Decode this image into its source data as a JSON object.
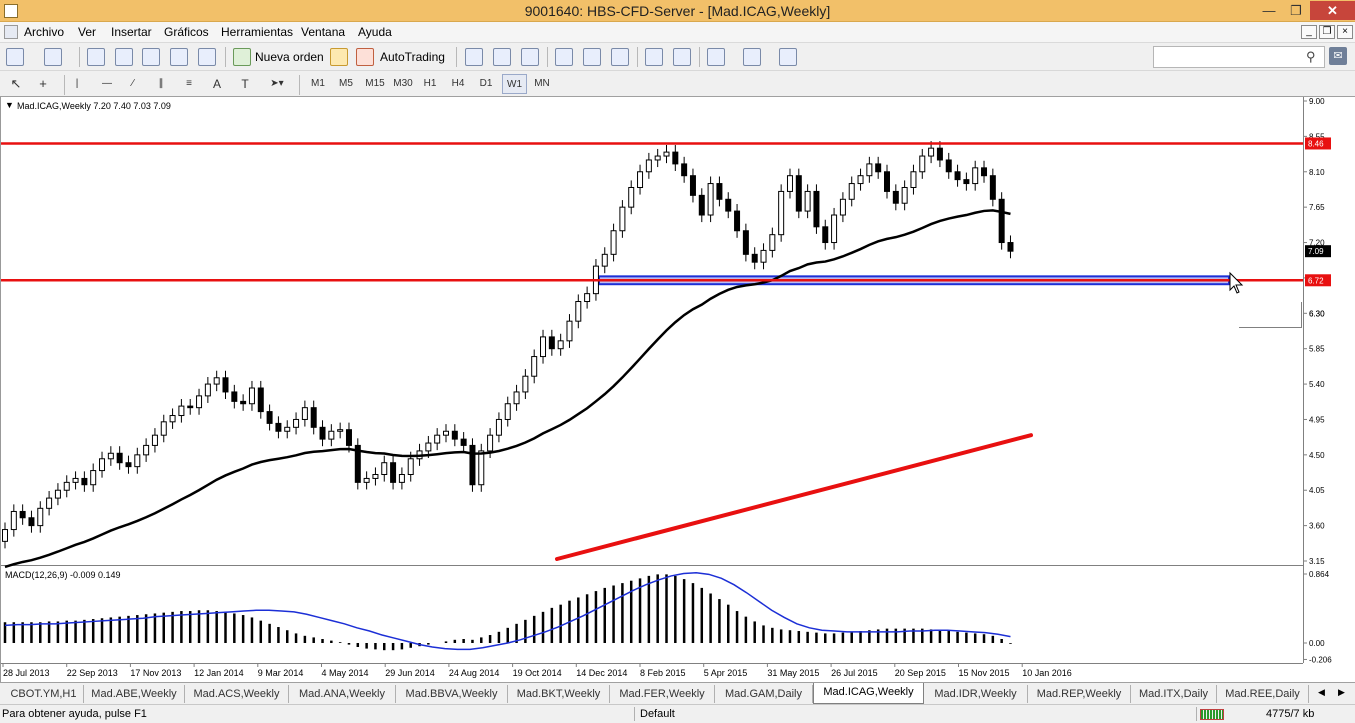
{
  "window": {
    "title": "9001640: HBS-CFD-Server - [Mad.ICAG,Weekly]"
  },
  "menu": [
    "Archivo",
    "Ver",
    "Insertar",
    "Gráficos",
    "Herramientas",
    "Ventana",
    "Ayuda"
  ],
  "toolbar": {
    "new_order": "Nueva orden",
    "autotrading": "AutoTrading"
  },
  "timeframes": [
    "M1",
    "M5",
    "M15",
    "M30",
    "H1",
    "H4",
    "D1",
    "W1",
    "MN"
  ],
  "active_timeframe": "W1",
  "chart_header": "Mad.ICAG,Weekly  7.20 7.40 7.03 7.09",
  "macd_header": "MACD(12,26,9) -0.009 0.149",
  "price_labels": {
    "ask": "8.46",
    "current": "7.09",
    "support": "6.72",
    "crosshair": "6.30"
  },
  "chart_data": [
    {
      "type": "candlestick",
      "symbol": "Mad.ICAG",
      "timeframe": "Weekly",
      "ylim": [
        3.15,
        9.0
      ],
      "y_ticks": [
        "9.00",
        "8.55",
        "8.10",
        "7.65",
        "7.20",
        "6.75",
        "6.30",
        "5.85",
        "5.40",
        "4.95",
        "4.50",
        "4.05",
        "3.60",
        "3.15"
      ],
      "x_ticks": [
        "28 Jul 2013",
        "22 Sep 2013",
        "17 Nov 2013",
        "12 Jan 2014",
        "9 Mar 2014",
        "4 May 2014",
        "29 Jun 2014",
        "24 Aug 2014",
        "19 Oct 2014",
        "14 Dec 2014",
        "8 Feb 2015",
        "5 Apr 2015",
        "31 May 2015",
        "26 Jul 2015",
        "20 Sep 2015",
        "15 Nov 2015",
        "10 Jan 2016"
      ],
      "close": [
        3.55,
        3.78,
        3.7,
        3.6,
        3.82,
        3.95,
        4.05,
        4.15,
        4.2,
        4.12,
        4.3,
        4.45,
        4.52,
        4.4,
        4.35,
        4.5,
        4.62,
        4.75,
        4.92,
        5.0,
        5.12,
        5.1,
        5.25,
        5.4,
        5.48,
        5.3,
        5.18,
        5.15,
        5.35,
        5.05,
        4.9,
        4.8,
        4.85,
        4.95,
        5.1,
        4.85,
        4.7,
        4.8,
        4.82,
        4.62,
        4.15,
        4.2,
        4.25,
        4.4,
        4.15,
        4.25,
        4.45,
        4.55,
        4.65,
        4.75,
        4.8,
        4.7,
        4.62,
        4.12,
        4.55,
        4.75,
        4.95,
        5.15,
        5.3,
        5.5,
        5.75,
        6.0,
        5.85,
        5.95,
        6.2,
        6.45,
        6.55,
        6.9,
        7.05,
        7.35,
        7.65,
        7.9,
        8.1,
        8.25,
        8.3,
        8.35,
        8.2,
        8.05,
        7.8,
        7.55,
        7.95,
        7.75,
        7.6,
        7.35,
        7.05,
        6.95,
        7.1,
        7.3,
        7.85,
        8.05,
        7.6,
        7.85,
        7.4,
        7.2,
        7.55,
        7.75,
        7.95,
        8.05,
        8.2,
        8.1,
        7.85,
        7.7,
        7.9,
        8.1,
        8.3,
        8.4,
        8.25,
        8.1,
        8.0,
        7.95,
        8.15,
        8.05,
        7.75,
        7.2,
        7.09
      ],
      "ema_40_last": 7.85,
      "horizontal_lines": [
        8.46,
        6.72
      ],
      "rectangle_zone": [
        6.67,
        6.77
      ],
      "trendline": [
        [
          3.15,
          4.75
        ]
      ]
    },
    {
      "type": "macd",
      "params": "12,26,9",
      "ylim": [
        -0.206,
        0.864
      ],
      "y_ticks": [
        "0.864",
        "0.00",
        "-0.206"
      ],
      "histogram": [
        0.26,
        0.26,
        0.26,
        0.26,
        0.26,
        0.27,
        0.27,
        0.28,
        0.28,
        0.29,
        0.3,
        0.31,
        0.32,
        0.33,
        0.34,
        0.35,
        0.36,
        0.37,
        0.38,
        0.39,
        0.4,
        0.4,
        0.41,
        0.41,
        0.4,
        0.39,
        0.37,
        0.35,
        0.32,
        0.28,
        0.24,
        0.2,
        0.16,
        0.12,
        0.09,
        0.07,
        0.05,
        0.03,
        0.01,
        -0.02,
        -0.05,
        -0.07,
        -0.08,
        -0.09,
        -0.09,
        -0.08,
        -0.06,
        -0.04,
        -0.02,
        0.0,
        0.02,
        0.04,
        0.05,
        0.04,
        0.07,
        0.1,
        0.14,
        0.19,
        0.24,
        0.29,
        0.34,
        0.39,
        0.44,
        0.48,
        0.53,
        0.57,
        0.61,
        0.65,
        0.69,
        0.72,
        0.75,
        0.78,
        0.81,
        0.84,
        0.86,
        0.86,
        0.84,
        0.8,
        0.75,
        0.69,
        0.62,
        0.55,
        0.48,
        0.4,
        0.33,
        0.27,
        0.22,
        0.19,
        0.17,
        0.16,
        0.15,
        0.14,
        0.13,
        0.12,
        0.12,
        0.13,
        0.14,
        0.15,
        0.16,
        0.17,
        0.18,
        0.18,
        0.18,
        0.18,
        0.18,
        0.17,
        0.16,
        0.15,
        0.14,
        0.13,
        0.12,
        0.11,
        0.09,
        0.05,
        -0.01
      ],
      "signal_line": [
        0.22,
        0.23,
        0.23,
        0.24,
        0.24,
        0.25,
        0.26,
        0.27,
        0.28,
        0.29,
        0.3,
        0.31,
        0.33,
        0.34,
        0.35,
        0.36,
        0.37,
        0.38,
        0.39,
        0.4,
        0.41,
        0.41,
        0.4,
        0.39,
        0.36,
        0.32,
        0.28,
        0.24,
        0.19,
        0.15,
        0.1,
        0.06,
        0.02,
        -0.02,
        -0.05,
        -0.07,
        -0.08,
        -0.08,
        -0.06,
        -0.03,
        0.0,
        0.04,
        0.09,
        0.14,
        0.2,
        0.27,
        0.34,
        0.42,
        0.5,
        0.58,
        0.66,
        0.73,
        0.79,
        0.84,
        0.87,
        0.88,
        0.86,
        0.81,
        0.73,
        0.63,
        0.52,
        0.41,
        0.32,
        0.24,
        0.19,
        0.16,
        0.15,
        0.14,
        0.14,
        0.14,
        0.14,
        0.14,
        0.15,
        0.15,
        0.16,
        0.16,
        0.15,
        0.14,
        0.13,
        0.11,
        0.08
      ]
    }
  ],
  "tabs": [
    "CBOT.YM,H1",
    "Mad.ABE,Weekly",
    "Mad.ACS,Weekly",
    "Mad.ANA,Weekly",
    "Mad.BBVA,Weekly",
    "Mad.BKT,Weekly",
    "Mad.FER,Weekly",
    "Mad.GAM,Daily",
    "Mad.ICAG,Weekly",
    "Mad.IDR,Weekly",
    "Mad.REP,Weekly",
    "Mad.ITX,Daily",
    "Mad.REE,Daily"
  ],
  "active_tab": "Mad.ICAG,Weekly",
  "status": {
    "help": "Para obtener ayuda, pulse F1",
    "profile": "Default",
    "traffic": "4775/7 kb"
  },
  "colors": {
    "titlebar": "#f2c069",
    "hline": "#e81010",
    "trendline": "#e81010",
    "ema": "#000000",
    "macd_signal": "#1c2fd6",
    "zone": "#1c2fd6"
  }
}
